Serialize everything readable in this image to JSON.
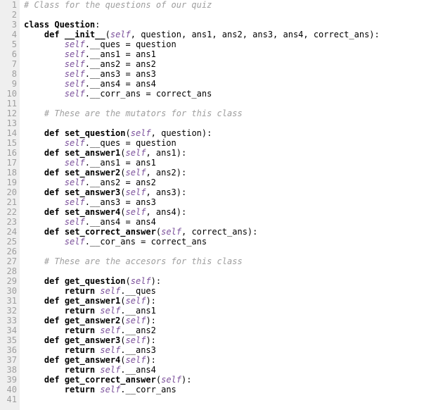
{
  "lines": [
    {
      "num": 1,
      "tokens": [
        {
          "cls": "tok-comment",
          "t": "# Class for the questions of our quiz"
        }
      ]
    },
    {
      "num": 2,
      "tokens": []
    },
    {
      "num": 3,
      "tokens": [
        {
          "cls": "tok-keyword",
          "t": "class "
        },
        {
          "cls": "tok-defname",
          "t": "Question"
        },
        {
          "cls": "tok-plain",
          "t": ":"
        }
      ]
    },
    {
      "num": 4,
      "tokens": [
        {
          "cls": "tok-plain",
          "t": "    "
        },
        {
          "cls": "tok-keyword",
          "t": "def "
        },
        {
          "cls": "tok-defname",
          "t": "__init__"
        },
        {
          "cls": "tok-plain",
          "t": "("
        },
        {
          "cls": "tok-self",
          "t": "self"
        },
        {
          "cls": "tok-plain",
          "t": ", question, ans1, ans2, ans3, ans4, correct_ans):"
        }
      ]
    },
    {
      "num": 5,
      "tokens": [
        {
          "cls": "tok-plain",
          "t": "        "
        },
        {
          "cls": "tok-self",
          "t": "self"
        },
        {
          "cls": "tok-plain",
          "t": ".__ques = question"
        }
      ]
    },
    {
      "num": 6,
      "tokens": [
        {
          "cls": "tok-plain",
          "t": "        "
        },
        {
          "cls": "tok-self",
          "t": "self"
        },
        {
          "cls": "tok-plain",
          "t": ".__ans1 = ans1"
        }
      ]
    },
    {
      "num": 7,
      "tokens": [
        {
          "cls": "tok-plain",
          "t": "        "
        },
        {
          "cls": "tok-self",
          "t": "self"
        },
        {
          "cls": "tok-plain",
          "t": ".__ans2 = ans2"
        }
      ]
    },
    {
      "num": 8,
      "tokens": [
        {
          "cls": "tok-plain",
          "t": "        "
        },
        {
          "cls": "tok-self",
          "t": "self"
        },
        {
          "cls": "tok-plain",
          "t": ".__ans3 = ans3"
        }
      ]
    },
    {
      "num": 9,
      "tokens": [
        {
          "cls": "tok-plain",
          "t": "        "
        },
        {
          "cls": "tok-self",
          "t": "self"
        },
        {
          "cls": "tok-plain",
          "t": ".__ans4 = ans4"
        }
      ]
    },
    {
      "num": 10,
      "tokens": [
        {
          "cls": "tok-plain",
          "t": "        "
        },
        {
          "cls": "tok-self",
          "t": "self"
        },
        {
          "cls": "tok-plain",
          "t": ".__corr_ans = correct_ans"
        }
      ]
    },
    {
      "num": 11,
      "tokens": []
    },
    {
      "num": 12,
      "tokens": [
        {
          "cls": "tok-plain",
          "t": "    "
        },
        {
          "cls": "tok-comment",
          "t": "# These are the mutators for this class"
        }
      ]
    },
    {
      "num": 13,
      "tokens": []
    },
    {
      "num": 14,
      "tokens": [
        {
          "cls": "tok-plain",
          "t": "    "
        },
        {
          "cls": "tok-keyword",
          "t": "def "
        },
        {
          "cls": "tok-defname",
          "t": "set_question"
        },
        {
          "cls": "tok-plain",
          "t": "("
        },
        {
          "cls": "tok-self",
          "t": "self"
        },
        {
          "cls": "tok-plain",
          "t": ", question):"
        }
      ]
    },
    {
      "num": 15,
      "tokens": [
        {
          "cls": "tok-plain",
          "t": "        "
        },
        {
          "cls": "tok-self",
          "t": "self"
        },
        {
          "cls": "tok-plain",
          "t": ".__ques = question"
        }
      ]
    },
    {
      "num": 16,
      "tokens": [
        {
          "cls": "tok-plain",
          "t": "    "
        },
        {
          "cls": "tok-keyword",
          "t": "def "
        },
        {
          "cls": "tok-defname",
          "t": "set_answer1"
        },
        {
          "cls": "tok-plain",
          "t": "("
        },
        {
          "cls": "tok-self",
          "t": "self"
        },
        {
          "cls": "tok-plain",
          "t": ", ans1):"
        }
      ]
    },
    {
      "num": 17,
      "tokens": [
        {
          "cls": "tok-plain",
          "t": "        "
        },
        {
          "cls": "tok-self",
          "t": "self"
        },
        {
          "cls": "tok-plain",
          "t": ".__ans1 = ans1"
        }
      ]
    },
    {
      "num": 18,
      "tokens": [
        {
          "cls": "tok-plain",
          "t": "    "
        },
        {
          "cls": "tok-keyword",
          "t": "def "
        },
        {
          "cls": "tok-defname",
          "t": "set_answer2"
        },
        {
          "cls": "tok-plain",
          "t": "("
        },
        {
          "cls": "tok-self",
          "t": "self"
        },
        {
          "cls": "tok-plain",
          "t": ", ans2):"
        }
      ]
    },
    {
      "num": 19,
      "tokens": [
        {
          "cls": "tok-plain",
          "t": "        "
        },
        {
          "cls": "tok-self",
          "t": "self"
        },
        {
          "cls": "tok-plain",
          "t": ".__ans2 = ans2"
        }
      ]
    },
    {
      "num": 20,
      "tokens": [
        {
          "cls": "tok-plain",
          "t": "    "
        },
        {
          "cls": "tok-keyword",
          "t": "def "
        },
        {
          "cls": "tok-defname",
          "t": "set_answer3"
        },
        {
          "cls": "tok-plain",
          "t": "("
        },
        {
          "cls": "tok-self",
          "t": "self"
        },
        {
          "cls": "tok-plain",
          "t": ", ans3):"
        }
      ]
    },
    {
      "num": 21,
      "tokens": [
        {
          "cls": "tok-plain",
          "t": "        "
        },
        {
          "cls": "tok-self",
          "t": "self"
        },
        {
          "cls": "tok-plain",
          "t": ".__ans3 = ans3"
        }
      ]
    },
    {
      "num": 22,
      "tokens": [
        {
          "cls": "tok-plain",
          "t": "    "
        },
        {
          "cls": "tok-keyword",
          "t": "def "
        },
        {
          "cls": "tok-defname",
          "t": "set_answer4"
        },
        {
          "cls": "tok-plain",
          "t": "("
        },
        {
          "cls": "tok-self",
          "t": "self"
        },
        {
          "cls": "tok-plain",
          "t": ", ans4):"
        }
      ]
    },
    {
      "num": 23,
      "tokens": [
        {
          "cls": "tok-plain",
          "t": "        "
        },
        {
          "cls": "tok-self",
          "t": "self"
        },
        {
          "cls": "tok-plain",
          "t": ".__ans4 = ans4"
        }
      ]
    },
    {
      "num": 24,
      "tokens": [
        {
          "cls": "tok-plain",
          "t": "    "
        },
        {
          "cls": "tok-keyword",
          "t": "def "
        },
        {
          "cls": "tok-defname",
          "t": "set_correct_answer"
        },
        {
          "cls": "tok-plain",
          "t": "("
        },
        {
          "cls": "tok-self",
          "t": "self"
        },
        {
          "cls": "tok-plain",
          "t": ", correct_ans):"
        }
      ]
    },
    {
      "num": 25,
      "tokens": [
        {
          "cls": "tok-plain",
          "t": "        "
        },
        {
          "cls": "tok-self",
          "t": "self"
        },
        {
          "cls": "tok-plain",
          "t": ".__cor_ans = correct_ans"
        }
      ]
    },
    {
      "num": 26,
      "tokens": []
    },
    {
      "num": 27,
      "tokens": [
        {
          "cls": "tok-plain",
          "t": "    "
        },
        {
          "cls": "tok-comment",
          "t": "# These are the accesors for this class"
        }
      ]
    },
    {
      "num": 28,
      "tokens": []
    },
    {
      "num": 29,
      "tokens": [
        {
          "cls": "tok-plain",
          "t": "    "
        },
        {
          "cls": "tok-keyword",
          "t": "def "
        },
        {
          "cls": "tok-defname",
          "t": "get_question"
        },
        {
          "cls": "tok-plain",
          "t": "("
        },
        {
          "cls": "tok-self",
          "t": "self"
        },
        {
          "cls": "tok-plain",
          "t": "):"
        }
      ]
    },
    {
      "num": 30,
      "tokens": [
        {
          "cls": "tok-plain",
          "t": "        "
        },
        {
          "cls": "tok-keyword",
          "t": "return"
        },
        {
          "cls": "tok-plain",
          "t": " "
        },
        {
          "cls": "tok-self",
          "t": "self"
        },
        {
          "cls": "tok-plain",
          "t": ".__ques"
        }
      ]
    },
    {
      "num": 31,
      "tokens": [
        {
          "cls": "tok-plain",
          "t": "    "
        },
        {
          "cls": "tok-keyword",
          "t": "def "
        },
        {
          "cls": "tok-defname",
          "t": "get_answer1"
        },
        {
          "cls": "tok-plain",
          "t": "("
        },
        {
          "cls": "tok-self",
          "t": "self"
        },
        {
          "cls": "tok-plain",
          "t": "):"
        }
      ]
    },
    {
      "num": 32,
      "tokens": [
        {
          "cls": "tok-plain",
          "t": "        "
        },
        {
          "cls": "tok-keyword",
          "t": "return"
        },
        {
          "cls": "tok-plain",
          "t": " "
        },
        {
          "cls": "tok-self",
          "t": "self"
        },
        {
          "cls": "tok-plain",
          "t": ".__ans1"
        }
      ]
    },
    {
      "num": 33,
      "tokens": [
        {
          "cls": "tok-plain",
          "t": "    "
        },
        {
          "cls": "tok-keyword",
          "t": "def "
        },
        {
          "cls": "tok-defname",
          "t": "get_answer2"
        },
        {
          "cls": "tok-plain",
          "t": "("
        },
        {
          "cls": "tok-self",
          "t": "self"
        },
        {
          "cls": "tok-plain",
          "t": "):"
        }
      ]
    },
    {
      "num": 34,
      "tokens": [
        {
          "cls": "tok-plain",
          "t": "        "
        },
        {
          "cls": "tok-keyword",
          "t": "return"
        },
        {
          "cls": "tok-plain",
          "t": " "
        },
        {
          "cls": "tok-self",
          "t": "self"
        },
        {
          "cls": "tok-plain",
          "t": ".__ans2"
        }
      ]
    },
    {
      "num": 35,
      "tokens": [
        {
          "cls": "tok-plain",
          "t": "    "
        },
        {
          "cls": "tok-keyword",
          "t": "def "
        },
        {
          "cls": "tok-defname",
          "t": "get_answer3"
        },
        {
          "cls": "tok-plain",
          "t": "("
        },
        {
          "cls": "tok-self",
          "t": "self"
        },
        {
          "cls": "tok-plain",
          "t": "):"
        }
      ]
    },
    {
      "num": 36,
      "tokens": [
        {
          "cls": "tok-plain",
          "t": "        "
        },
        {
          "cls": "tok-keyword",
          "t": "return"
        },
        {
          "cls": "tok-plain",
          "t": " "
        },
        {
          "cls": "tok-self",
          "t": "self"
        },
        {
          "cls": "tok-plain",
          "t": ".__ans3"
        }
      ]
    },
    {
      "num": 37,
      "tokens": [
        {
          "cls": "tok-plain",
          "t": "    "
        },
        {
          "cls": "tok-keyword",
          "t": "def "
        },
        {
          "cls": "tok-defname",
          "t": "get_answer4"
        },
        {
          "cls": "tok-plain",
          "t": "("
        },
        {
          "cls": "tok-self",
          "t": "self"
        },
        {
          "cls": "tok-plain",
          "t": "):"
        }
      ]
    },
    {
      "num": 38,
      "tokens": [
        {
          "cls": "tok-plain",
          "t": "        "
        },
        {
          "cls": "tok-keyword",
          "t": "return"
        },
        {
          "cls": "tok-plain",
          "t": " "
        },
        {
          "cls": "tok-self",
          "t": "self"
        },
        {
          "cls": "tok-plain",
          "t": ".__ans4"
        }
      ]
    },
    {
      "num": 39,
      "tokens": [
        {
          "cls": "tok-plain",
          "t": "    "
        },
        {
          "cls": "tok-keyword",
          "t": "def "
        },
        {
          "cls": "tok-defname",
          "t": "get_correct_answer"
        },
        {
          "cls": "tok-plain",
          "t": "("
        },
        {
          "cls": "tok-self",
          "t": "self"
        },
        {
          "cls": "tok-plain",
          "t": "):"
        }
      ]
    },
    {
      "num": 40,
      "tokens": [
        {
          "cls": "tok-plain",
          "t": "        "
        },
        {
          "cls": "tok-keyword",
          "t": "return"
        },
        {
          "cls": "tok-plain",
          "t": " "
        },
        {
          "cls": "tok-self",
          "t": "self"
        },
        {
          "cls": "tok-plain",
          "t": ".__corr_ans"
        }
      ]
    },
    {
      "num": 41,
      "tokens": []
    }
  ]
}
